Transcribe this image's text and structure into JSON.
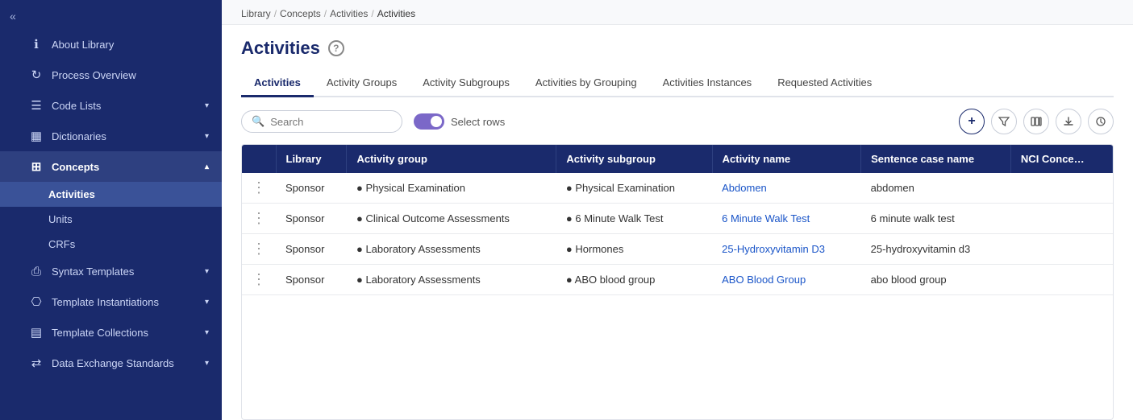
{
  "sidebar": {
    "collapse_icon": "«",
    "items": [
      {
        "id": "about-library",
        "label": "About Library",
        "icon": "ℹ",
        "has_chevron": false,
        "active": false
      },
      {
        "id": "process-overview",
        "label": "Process Overview",
        "icon": "⟳",
        "has_chevron": false,
        "active": false
      },
      {
        "id": "code-lists",
        "label": "Code Lists",
        "icon": "☰",
        "has_chevron": true,
        "active": false
      },
      {
        "id": "dictionaries",
        "label": "Dictionaries",
        "icon": "📖",
        "has_chevron": true,
        "active": false
      },
      {
        "id": "concepts",
        "label": "Concepts",
        "icon": "⊞",
        "has_chevron": true,
        "active": true,
        "sub_items": [
          {
            "id": "activities",
            "label": "Activities",
            "active": true
          },
          {
            "id": "units",
            "label": "Units",
            "active": false
          },
          {
            "id": "crfs",
            "label": "CRFs",
            "active": false
          }
        ]
      },
      {
        "id": "syntax-templates",
        "label": "Syntax Templates",
        "icon": "⎙",
        "has_chevron": true,
        "active": false
      },
      {
        "id": "template-instantiations",
        "label": "Template Instantiations",
        "icon": "⎔",
        "has_chevron": true,
        "active": false
      },
      {
        "id": "template-collections",
        "label": "Template Collections",
        "icon": "▤",
        "has_chevron": true,
        "active": false
      },
      {
        "id": "data-exchange-standards",
        "label": "Data Exchange Standards",
        "icon": "⇄",
        "has_chevron": true,
        "active": false
      }
    ]
  },
  "breadcrumb": {
    "items": [
      {
        "label": "Library",
        "link": true
      },
      {
        "label": "Concepts",
        "link": true
      },
      {
        "label": "Activities",
        "link": true
      },
      {
        "label": "Activities",
        "link": false
      }
    ]
  },
  "page": {
    "title": "Activities",
    "help_icon": "?"
  },
  "tabs": [
    {
      "id": "activities",
      "label": "Activities",
      "active": true
    },
    {
      "id": "activity-groups",
      "label": "Activity Groups",
      "active": false
    },
    {
      "id": "activity-subgroups",
      "label": "Activity Subgroups",
      "active": false
    },
    {
      "id": "activities-by-grouping",
      "label": "Activities by Grouping",
      "active": false
    },
    {
      "id": "activities-instances",
      "label": "Activities Instances",
      "active": false
    },
    {
      "id": "requested-activities",
      "label": "Requested Activities",
      "active": false
    }
  ],
  "toolbar": {
    "search_placeholder": "Search",
    "select_rows_label": "Select rows"
  },
  "table": {
    "columns": [
      "",
      "Library",
      "Activity group",
      "Activity subgroup",
      "Activity name",
      "Sentence case name",
      "NCI Conce…"
    ],
    "rows": [
      {
        "library": "Sponsor",
        "activity_group": "Physical Examination",
        "activity_subgroup": "Physical Examination",
        "activity_name": "Abdomen",
        "sentence_case_name": "abdomen",
        "nci": ""
      },
      {
        "library": "Sponsor",
        "activity_group": "Clinical Outcome Assessments",
        "activity_subgroup": "6 Minute Walk Test",
        "activity_name": "6 Minute Walk Test",
        "sentence_case_name": "6 minute walk test",
        "nci": ""
      },
      {
        "library": "Sponsor",
        "activity_group": "Laboratory Assessments",
        "activity_subgroup": "Hormones",
        "activity_name": "25-Hydroxyvitamin D3",
        "sentence_case_name": "25-hydroxyvitamin d3",
        "nci": ""
      },
      {
        "library": "Sponsor",
        "activity_group": "Laboratory Assessments",
        "activity_subgroup": "ABO blood group",
        "activity_name": "ABO Blood Group",
        "sentence_case_name": "abo blood group",
        "nci": ""
      }
    ]
  }
}
